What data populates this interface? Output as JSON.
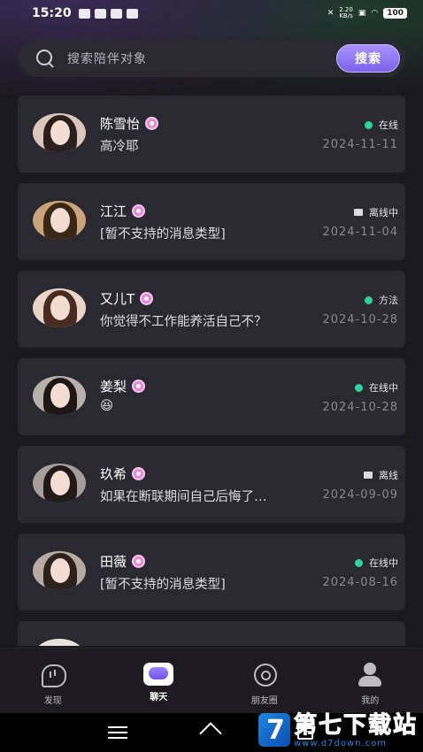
{
  "status_bar": {
    "time": "15:20",
    "net_speed_value": "2.20",
    "net_speed_unit": "KB/s",
    "battery": "100"
  },
  "search": {
    "placeholder": "搜索陪伴对象",
    "button_label": "搜索"
  },
  "chats": [
    {
      "name": "陈雪怡",
      "message": "高冷耶",
      "status": "在线",
      "status_type": "online",
      "date": "2024-11-11"
    },
    {
      "name": "江江",
      "message": "[暂不支持的消息类型]",
      "status": "离线中",
      "status_type": "offline",
      "date": "2024-11-04"
    },
    {
      "name": "又儿T",
      "message": "你觉得不工作能养活自己不？",
      "status": "方法",
      "status_type": "online",
      "date": "2024-10-28"
    },
    {
      "name": "姜梨",
      "message": "😆",
      "status": "在线中",
      "status_type": "online",
      "date": "2024-10-28"
    },
    {
      "name": "玖希",
      "message": "如果在断联期间自己后悔了…",
      "status": "离线",
      "status_type": "offline",
      "date": "2024-09-09"
    },
    {
      "name": "田薇",
      "message": "[暂不支持的消息类型]",
      "status": "在线中",
      "status_type": "online",
      "date": "2024-08-16"
    }
  ],
  "tabs": [
    {
      "label": "发现",
      "icon": "discover-icon",
      "active": false
    },
    {
      "label": "聊天",
      "icon": "chat-icon",
      "active": true
    },
    {
      "label": "朋友圈",
      "icon": "moments-icon",
      "active": false
    },
    {
      "label": "我的",
      "icon": "profile-icon",
      "active": false
    }
  ],
  "watermark": {
    "title": "第七下载站",
    "url": "www.d7down.com"
  },
  "colors": {
    "accent": "#8a72f5",
    "online": "#2fd39a",
    "card": "#2a2830",
    "background": "#1b1920"
  }
}
